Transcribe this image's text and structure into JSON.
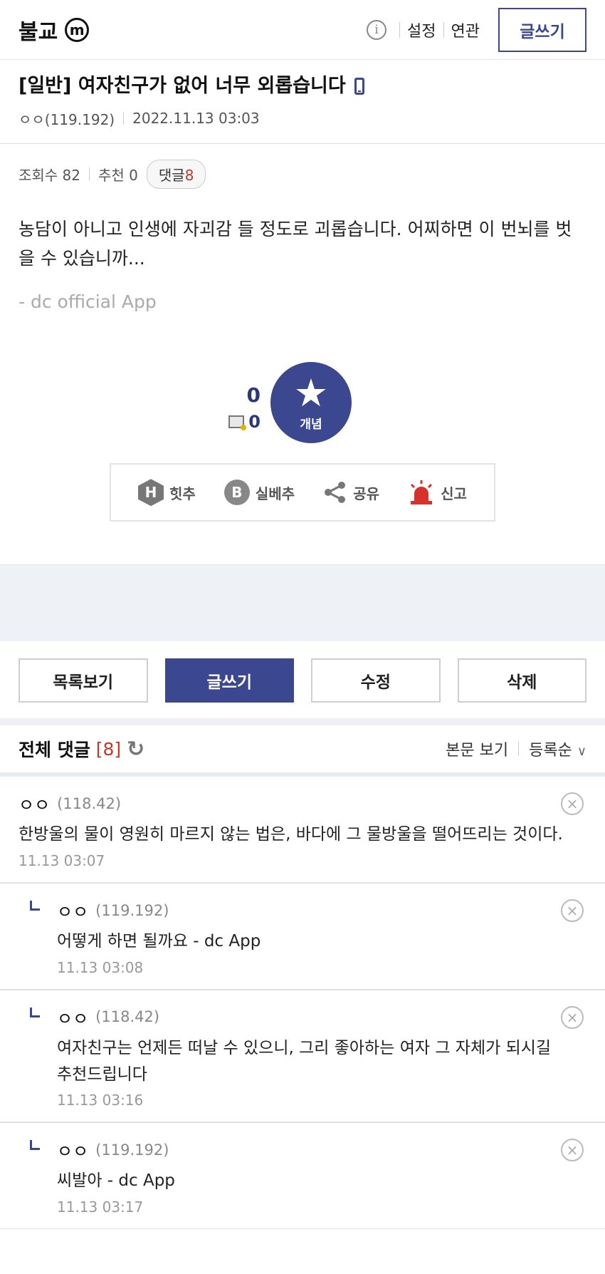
{
  "header": {
    "gallery_name": "불교",
    "minor_badge": "m",
    "info_icon": "i",
    "settings": "설정",
    "related": "연관",
    "write": "글쓰기"
  },
  "post": {
    "title": "[일반] 여자친구가 없어 너무 외롭습니다",
    "author": "ㅇㅇ(119.192)",
    "datetime": "2022.11.13 03:03",
    "views": "조회수 82",
    "recommend": "추천 0",
    "comment_label": "댓글",
    "comment_count": "8",
    "body": "농담이 아니고 인생에 자괴감 들 정도로 괴롭습니다. 어찌하면 이 번뇌를 벗을 수 있습니까...",
    "signature": "- dc official App"
  },
  "recommend_area": {
    "up_count": "0",
    "fixed_count": "0",
    "star_glyph": "★",
    "star_label": "개념"
  },
  "actions": {
    "hit_letter": "H",
    "hit": "힛추",
    "best_letter": "B",
    "best": "실베추",
    "share_glyph": "<",
    "share": "공유",
    "report": "신고"
  },
  "buttons": {
    "list": "목록보기",
    "write": "글쓰기",
    "edit": "수정",
    "delete": "삭제"
  },
  "comments_header": {
    "title": "전체 댓글",
    "count": "[8]",
    "refresh_glyph": "↻",
    "view_body": "본문 보기",
    "sort": "등록순",
    "chevron": "∨"
  },
  "comments": [
    {
      "author": "ㅇㅇ",
      "ip": "(118.42)",
      "text": "한방울의 물이 영원히 마르지 않는 법은, 바다에 그 물방울을 떨어뜨리는 것이다.",
      "time": "11.13 03:07"
    },
    {
      "author": "ㅇㅇ",
      "ip": "(119.192)",
      "text": "어떻게 하면 될까요 - dc App",
      "time": "11.13 03:08"
    },
    {
      "author": "ㅇㅇ",
      "ip": "(118.42)",
      "text": "여자친구는 언제든 떠날 수 있으니, 그리 좋아하는 여자 그 자체가 되시길 추천드립니다",
      "time": "11.13 03:16"
    },
    {
      "author": "ㅇㅇ",
      "ip": "(119.192)",
      "text": "씨발아 - dc App",
      "time": "11.13 03:17"
    }
  ],
  "delete_glyph": "×",
  "colors": {
    "accent": "#3b4890",
    "count_red": "#c0392b",
    "report_red": "#d9302c"
  }
}
